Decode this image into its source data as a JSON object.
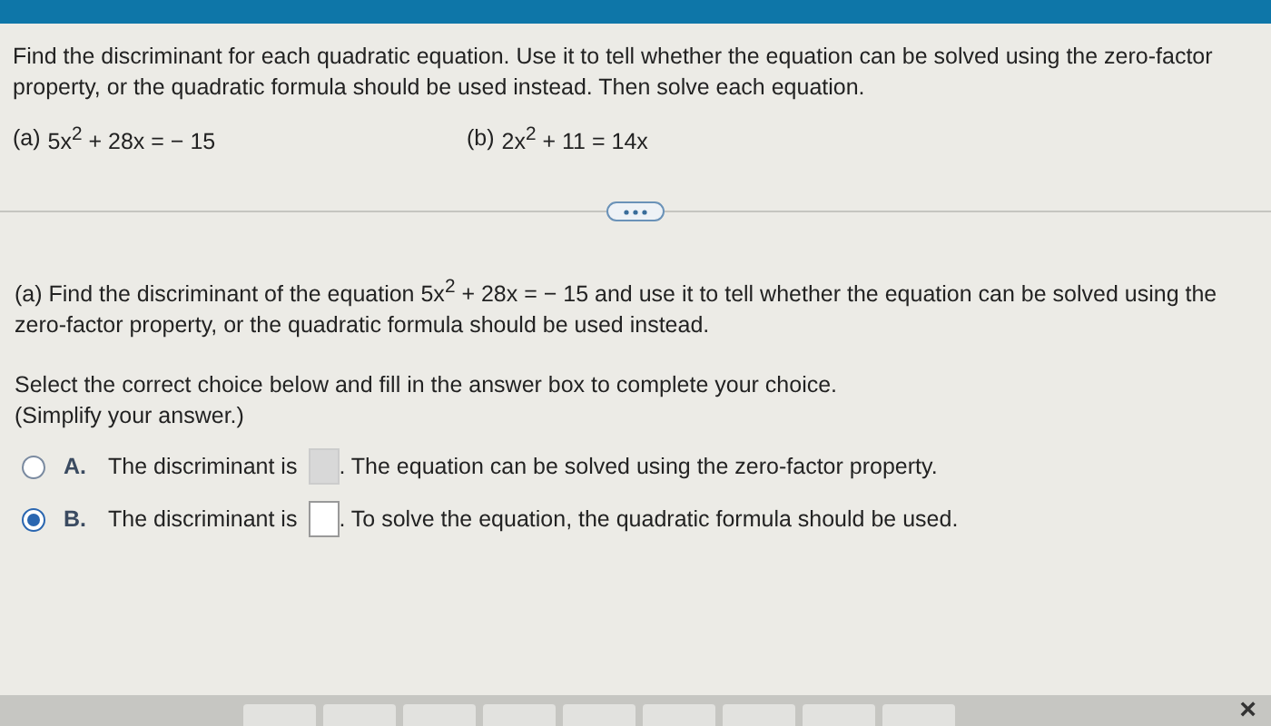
{
  "instructions": "Find the discriminant for each quadratic equation. Use it to tell whether the equation can be solved using the zero-factor property, or the quadratic formula should be used instead. Then solve each equation.",
  "equations": [
    {
      "label": "(a)",
      "text": "5x$^{2}$ + 28x = − 15"
    },
    {
      "label": "(b)",
      "text": "2x$^{2}$ + 11 = 14x"
    }
  ],
  "question": "(a) Find the discriminant of the equation 5x$^{2}$ + 28x = − 15 and use it to tell whether the equation can be solved using the zero-factor property, or the quadratic formula should be used instead.",
  "prompt": "Select the correct choice below and fill in the answer box to complete your choice.",
  "hint": "(Simplify your answer.)",
  "choices": [
    {
      "letter": "A.",
      "before": "The discriminant is",
      "after": ". The equation can be solved using the zero-factor property.",
      "selected": false
    },
    {
      "letter": "B.",
      "before": "The discriminant is",
      "after": ". To solve the equation, the quadratic formula should be used.",
      "selected": true
    }
  ],
  "toolbar": {
    "close": "×"
  }
}
